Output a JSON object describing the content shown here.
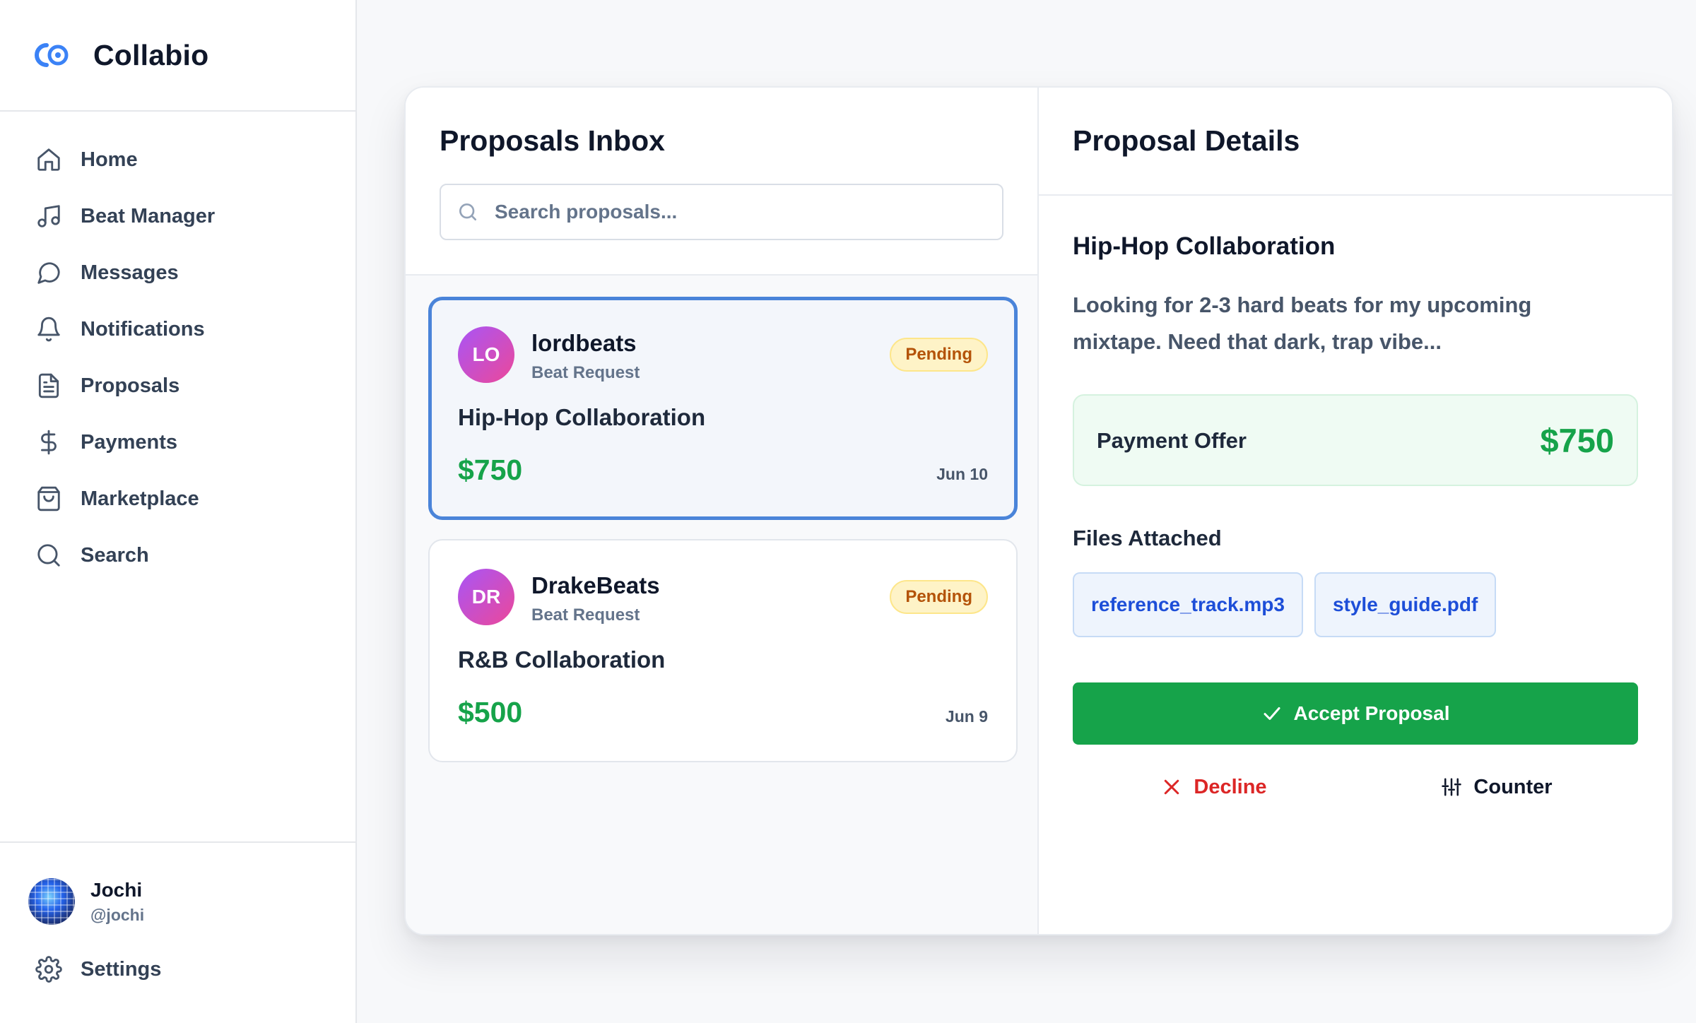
{
  "app": {
    "name": "Collabio",
    "logo_icon": "collabio-logo-icon"
  },
  "sidebar": {
    "items": [
      {
        "label": "Home",
        "icon": "home-icon"
      },
      {
        "label": "Beat Manager",
        "icon": "music-note-icon"
      },
      {
        "label": "Messages",
        "icon": "message-bubble-icon"
      },
      {
        "label": "Notifications",
        "icon": "bell-icon"
      },
      {
        "label": "Proposals",
        "icon": "document-icon"
      },
      {
        "label": "Payments",
        "icon": "dollar-icon"
      },
      {
        "label": "Marketplace",
        "icon": "shopping-bag-icon"
      },
      {
        "label": "Search",
        "icon": "search-icon"
      }
    ],
    "user": {
      "name": "Jochi",
      "handle": "@jochi"
    },
    "settings_label": "Settings"
  },
  "inbox": {
    "title": "Proposals Inbox",
    "search_placeholder": "Search proposals...",
    "proposals": [
      {
        "initials": "LO",
        "name": "lordbeats",
        "type": "Beat Request",
        "status": "Pending",
        "title": "Hip-Hop Collaboration",
        "amount": "$750",
        "date": "Jun 10",
        "selected": true
      },
      {
        "initials": "DR",
        "name": "DrakeBeats",
        "type": "Beat Request",
        "status": "Pending",
        "title": "R&B Collaboration",
        "amount": "$500",
        "date": "Jun 9",
        "selected": false
      }
    ]
  },
  "details": {
    "title": "Proposal Details",
    "proposal_title": "Hip-Hop Collaboration",
    "description": "Looking for 2-3 hard beats for my upcoming mixtape. Need that dark, trap vibe...",
    "offer_label": "Payment Offer",
    "offer_amount": "$750",
    "files_label": "Files Attached",
    "files": [
      "reference_track.mp3",
      "style_guide.pdf"
    ],
    "accept_label": "Accept Proposal",
    "decline_label": "Decline",
    "counter_label": "Counter"
  },
  "colors": {
    "accent_green": "#16a34a",
    "selected_border": "#4a84d9",
    "pending_badge_bg": "#fef3c7",
    "pending_badge_text": "#b45309",
    "decline_red": "#dc2626",
    "file_chip_text": "#1d4ed8"
  }
}
